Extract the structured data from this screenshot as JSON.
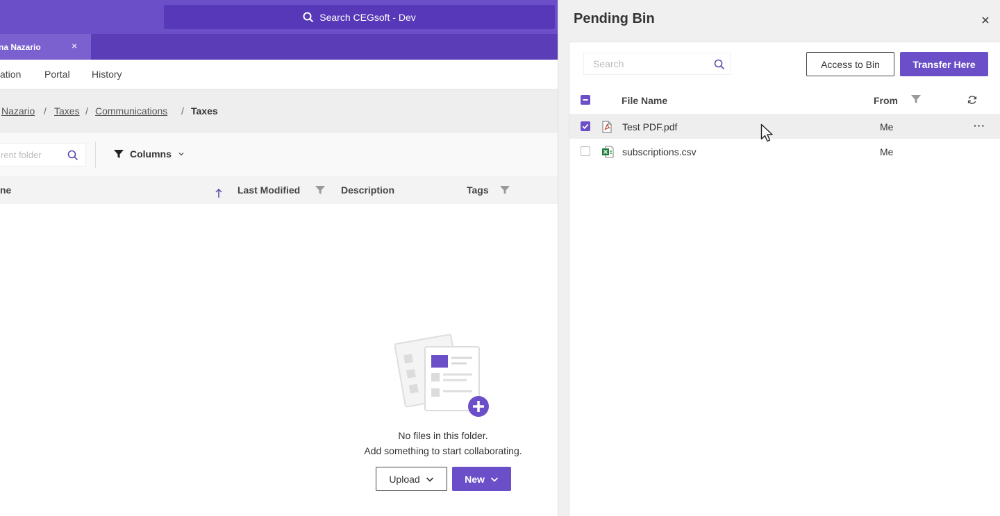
{
  "topbar": {
    "search_label": "Search CEGsoft - Dev"
  },
  "tab": {
    "label": "na Nazario",
    "close": "×"
  },
  "subnav": {
    "items": [
      "ation",
      "Portal",
      "History"
    ]
  },
  "breadcrumb": {
    "items": [
      "Nazario",
      "Taxes",
      "Communications"
    ],
    "separator": "/",
    "current": "Taxes"
  },
  "toolbar": {
    "folder_search_placeholder": "rent folder",
    "columns_label": "Columns"
  },
  "table": {
    "headers": [
      "ne",
      "Last Modified",
      "Description",
      "Tags"
    ]
  },
  "empty": {
    "line1": "No files in this folder.",
    "line2": "Add something to start collaborating.",
    "upload_label": "Upload",
    "new_label": "New"
  },
  "drawer": {
    "title": "Pending Bin",
    "search_placeholder": "Search",
    "access_label": "Access to Bin",
    "transfer_label": "Transfer Here",
    "headers": {
      "file_name": "File Name",
      "from": "From"
    },
    "files": [
      {
        "name": "Test PDF.pdf",
        "from": "Me",
        "type": "pdf",
        "checked": true,
        "more": "···"
      },
      {
        "name": "subscriptions.csv",
        "from": "Me",
        "type": "csv",
        "checked": false,
        "more": ""
      }
    ]
  },
  "colors": {
    "brand": "#6a4fc8",
    "topbar_search": "#5638b8",
    "excel_green": "#1e7e3e",
    "pdf_red": "#c0392b"
  }
}
